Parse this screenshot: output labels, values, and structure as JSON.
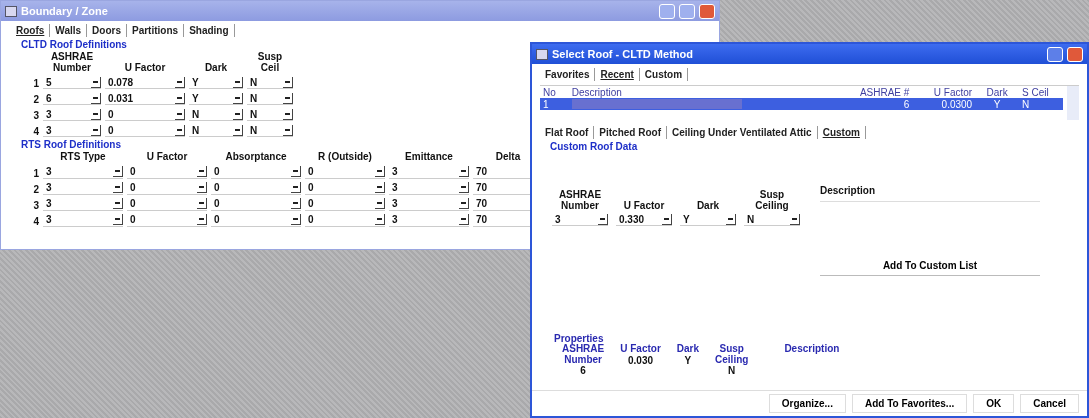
{
  "main_window": {
    "title": "Boundary / Zone",
    "tabs": [
      {
        "label": "Roofs",
        "selected": true
      },
      {
        "label": "Walls",
        "selected": false
      },
      {
        "label": "Doors",
        "selected": false
      },
      {
        "label": "Partitions",
        "selected": false
      },
      {
        "label": "Shading",
        "selected": false
      }
    ],
    "cltd": {
      "title": "CLTD Roof Definitions",
      "columns": [
        "ASHRAE\nNumber",
        "U Factor",
        "Dark",
        "Susp\nCeil"
      ],
      "rows": [
        {
          "index": "1",
          "values": [
            "5",
            "0.078",
            "Y",
            "N"
          ]
        },
        {
          "index": "2",
          "values": [
            "6",
            "0.031",
            "Y",
            "N"
          ]
        },
        {
          "index": "3",
          "values": [
            "3",
            "0",
            "N",
            "N"
          ]
        },
        {
          "index": "4",
          "values": [
            "3",
            "0",
            "N",
            "N"
          ]
        }
      ]
    },
    "rts": {
      "title": "RTS Roof Definitions",
      "columns": [
        "RTS Type",
        "U Factor",
        "Absorptance",
        "R (Outside)",
        "Emittance",
        "Delta"
      ],
      "rows": [
        {
          "index": "1",
          "values": [
            "3",
            "0",
            "0",
            "0",
            "3",
            "70"
          ]
        },
        {
          "index": "2",
          "values": [
            "3",
            "0",
            "0",
            "0",
            "3",
            "70"
          ]
        },
        {
          "index": "3",
          "values": [
            "3",
            "0",
            "0",
            "0",
            "3",
            "70"
          ]
        },
        {
          "index": "4",
          "values": [
            "3",
            "0",
            "0",
            "0",
            "3",
            "70"
          ]
        }
      ]
    }
  },
  "dialog": {
    "title": "Select Roof - CLTD Method",
    "tabs": [
      {
        "label": "Favorites",
        "selected": false
      },
      {
        "label": "Recent",
        "selected": true
      },
      {
        "label": "Custom",
        "selected": false
      }
    ],
    "list": {
      "columns": [
        "No",
        "Description",
        "ASHRAE #",
        "U Factor",
        "Dark",
        "S Ceil"
      ],
      "rows": [
        {
          "cells": [
            "1",
            "",
            "6",
            "0.0300",
            "Y",
            "N"
          ],
          "selected": true
        }
      ]
    },
    "subtabs": [
      {
        "label": "Flat Roof",
        "selected": false
      },
      {
        "label": "Pitched Roof",
        "selected": false
      },
      {
        "label": "Ceiling Under Ventilated Attic",
        "selected": false
      },
      {
        "label": "Custom",
        "selected": true
      }
    ],
    "custom": {
      "title": "Custom Roof Data",
      "fields": [
        {
          "label": "ASHRAE\nNumber",
          "value": "3"
        },
        {
          "label": "U Factor",
          "value": "0.330"
        },
        {
          "label": "Dark",
          "value": "Y"
        },
        {
          "label": "Susp\nCeiling",
          "value": "N"
        }
      ],
      "description_label": "Description",
      "add_button": "Add To Custom List"
    },
    "properties": {
      "title": "Properties",
      "items": [
        {
          "label": "ASHRAE\nNumber",
          "value": "6"
        },
        {
          "label": "U Factor",
          "value": "0.030"
        },
        {
          "label": "Dark",
          "value": "Y"
        },
        {
          "label": "Susp\nCeiling",
          "value": "N"
        }
      ],
      "description_label": "Description"
    },
    "buttons": [
      "Organize...",
      "Add To Favorites...",
      "OK",
      "Cancel"
    ]
  }
}
